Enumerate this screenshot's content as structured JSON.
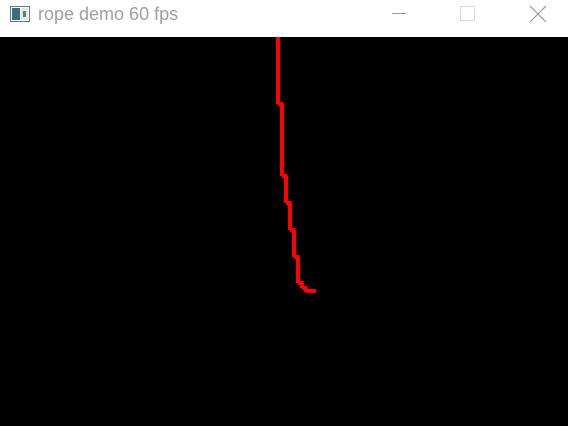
{
  "window": {
    "title": "rope demo 60 fps",
    "icon": "app-window-icon",
    "controls": {
      "minimize_icon": "minimize-icon",
      "maximize_icon": "maximize-icon",
      "close_icon": "close-icon"
    }
  },
  "canvas": {
    "background": "#000000",
    "rope_color": "#ff0000"
  },
  "colors": {
    "title_text": "#a0a0a0",
    "titlebar_bg": "#ffffff",
    "control_glyph": "#999999"
  }
}
